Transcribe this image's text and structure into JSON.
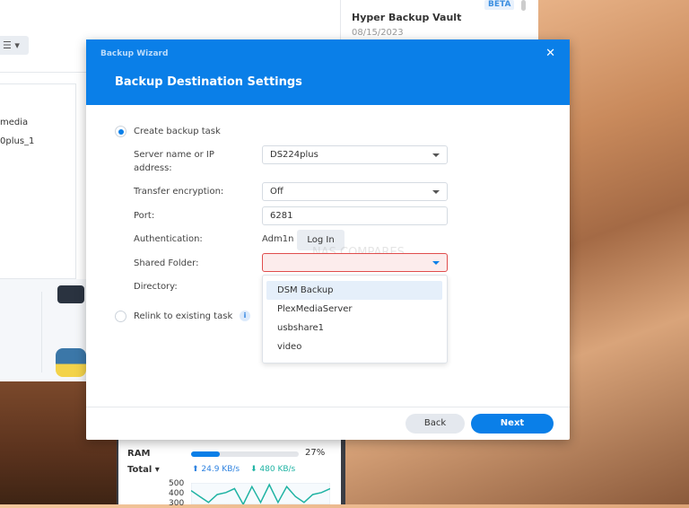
{
  "background_window": {
    "toolbar_icon": "☰ ▾",
    "list_items": [
      "media",
      "0plus_1"
    ]
  },
  "top_window": {
    "badge": "BETA",
    "title": "Hyper Backup Vault",
    "date": "08/15/2023"
  },
  "resource_widget": {
    "ram_label": "RAM",
    "ram_percent_value": 27,
    "ram_percent": "27%",
    "total_label": "Total ▾",
    "upload": "⬆ 24.9 KB/s",
    "download": "⬇ 480 KB/s",
    "y_ticks": [
      "500",
      "400",
      "300"
    ],
    "sparkline": [
      470,
      440,
      410,
      450,
      460,
      480,
      400,
      490,
      410,
      500,
      410,
      490,
      440,
      410,
      450,
      460,
      480
    ]
  },
  "dialog": {
    "window_title": "Backup Wizard",
    "heading": "Backup Destination Settings",
    "close": "✕",
    "option_create": "Create backup task",
    "server_label": "Server name or IP address:",
    "server_value": "DS224plus",
    "encryption_label": "Transfer encryption:",
    "encryption_value": "Off",
    "port_label": "Port:",
    "port_value": "6281",
    "auth_label": "Authentication:",
    "auth_user": "Adm1n",
    "login_button": "Log In",
    "shared_folder_label": "Shared Folder:",
    "shared_folder_value": "",
    "directory_label": "Directory:",
    "option_relink": "Relink to existing task",
    "info": "i",
    "watermark": "NAS COMPARES",
    "shared_folder_options": [
      "DSM Backup",
      "PlexMediaServer",
      "usbshare1",
      "video"
    ],
    "back_button": "Back",
    "next_button": "Next"
  }
}
